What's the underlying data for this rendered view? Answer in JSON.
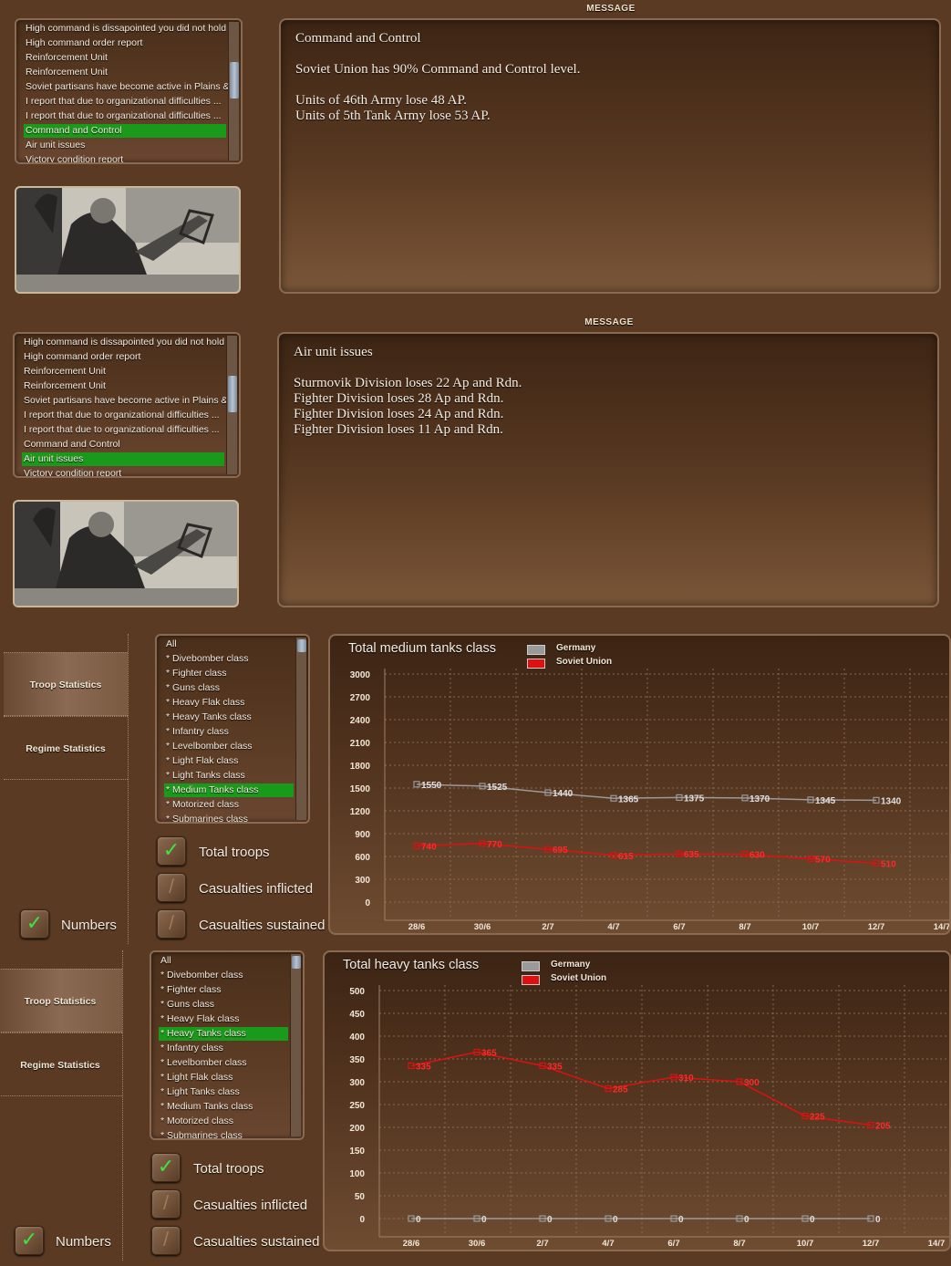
{
  "message_panels": [
    {
      "title": "MESSAGE",
      "list": [
        "High command is dissapointed you did not hold Li",
        "High command order report",
        "Reinforcement Unit",
        "Reinforcement Unit",
        "Soviet partisans have become active in Plains & F",
        "I report that due to  organizational difficulties ...",
        "I report that due to  organizational difficulties ...",
        "Command and Control",
        "Air unit issues",
        "Victory condition report"
      ],
      "selected_index": 7,
      "heading": "Command and Control",
      "body_lines": [
        "Soviet Union has 90% Command and Control level.",
        "",
        "Units of 46th Army lose 48 AP.",
        "Units of 5th Tank Army lose 53 AP."
      ]
    },
    {
      "title": "MESSAGE",
      "list": [
        "High command is dissapointed you did not hold Li",
        "High command order report",
        "Reinforcement Unit",
        "Reinforcement Unit",
        "Soviet partisans have become active in Plains & F",
        "I report that due to  organizational difficulties ...",
        "I report that due to  organizational difficulties ...",
        "Command and Control",
        "Air unit issues",
        "Victory condition report"
      ],
      "selected_index": 8,
      "heading": "Air unit issues",
      "body_lines": [
        "Sturmovik Division loses 22 Ap and Rdn.",
        "Fighter Division loses 28 Ap and Rdn.",
        "Fighter Division loses 24 Ap and Rdn.",
        "Fighter Division loses 11 Ap and Rdn."
      ]
    }
  ],
  "stat_panels": [
    {
      "tabs": [
        "Troop Statistics",
        "Regime Statistics"
      ],
      "active_tab": 0,
      "numbers_label": "Numbers",
      "numbers_checked": true,
      "class_list": [
        "All",
        "* Divebomber class",
        "* Fighter class",
        "* Guns class",
        "* Heavy Flak class",
        "* Heavy Tanks class",
        "* Infantry class",
        "* Levelbomber class",
        "* Light Flak class",
        "* Light Tanks class",
        "* Medium Tanks class",
        "* Motorized class",
        "* Submarines class"
      ],
      "selected_class": 10,
      "options": [
        {
          "label": "Total troops",
          "checked": true
        },
        {
          "label": "Casualties inflicted",
          "checked": false
        },
        {
          "label": "Casualties sustained",
          "checked": false
        }
      ]
    },
    {
      "tabs": [
        "Troop Statistics",
        "Regime Statistics"
      ],
      "active_tab": 0,
      "numbers_label": "Numbers",
      "numbers_checked": true,
      "class_list": [
        "All",
        "* Divebomber class",
        "* Fighter class",
        "* Guns class",
        "* Heavy Flak class",
        "* Heavy Tanks class",
        "* Infantry class",
        "* Levelbomber class",
        "* Light Flak class",
        "* Light Tanks class",
        "* Medium Tanks class",
        "* Motorized class",
        "* Submarines class"
      ],
      "selected_class": 5,
      "options": [
        {
          "label": "Total troops",
          "checked": true
        },
        {
          "label": "Casualties inflicted",
          "checked": false
        },
        {
          "label": "Casualties sustained",
          "checked": false
        }
      ]
    }
  ],
  "chart_data": [
    {
      "type": "line",
      "title": "Total medium tanks class",
      "categories": [
        "28/6",
        "30/6",
        "2/7",
        "4/7",
        "6/7",
        "8/7",
        "10/7",
        "12/7",
        "14/7"
      ],
      "yticks": [
        0,
        300,
        600,
        900,
        1200,
        1500,
        1800,
        2100,
        2400,
        2700,
        3000
      ],
      "ylim": [
        0,
        3000
      ],
      "grid": true,
      "legend_position": "top",
      "series": [
        {
          "name": "Germany",
          "color": "#9a9a9a",
          "values": [
            1550,
            1525,
            1440,
            1365,
            1375,
            1370,
            1345,
            1340
          ]
        },
        {
          "name": "Soviet Union",
          "color": "#e01010",
          "values": [
            740,
            770,
            695,
            615,
            635,
            630,
            570,
            510
          ]
        }
      ]
    },
    {
      "type": "line",
      "title": "Total heavy tanks class",
      "categories": [
        "28/6",
        "30/6",
        "2/7",
        "4/7",
        "6/7",
        "8/7",
        "10/7",
        "12/7",
        "14/7"
      ],
      "yticks": [
        0,
        50,
        100,
        150,
        200,
        250,
        300,
        350,
        400,
        450,
        500
      ],
      "ylim": [
        0,
        500
      ],
      "grid": true,
      "legend_position": "top",
      "series": [
        {
          "name": "Germany",
          "color": "#9a9a9a",
          "values": [
            0,
            0,
            0,
            0,
            0,
            0,
            0,
            0
          ]
        },
        {
          "name": "Soviet Union",
          "color": "#e01010",
          "values": [
            335,
            365,
            335,
            285,
            310,
            300,
            225,
            205
          ]
        }
      ]
    }
  ],
  "icons": {
    "check": "✓",
    "photo_subject": "soldiers-photo"
  }
}
